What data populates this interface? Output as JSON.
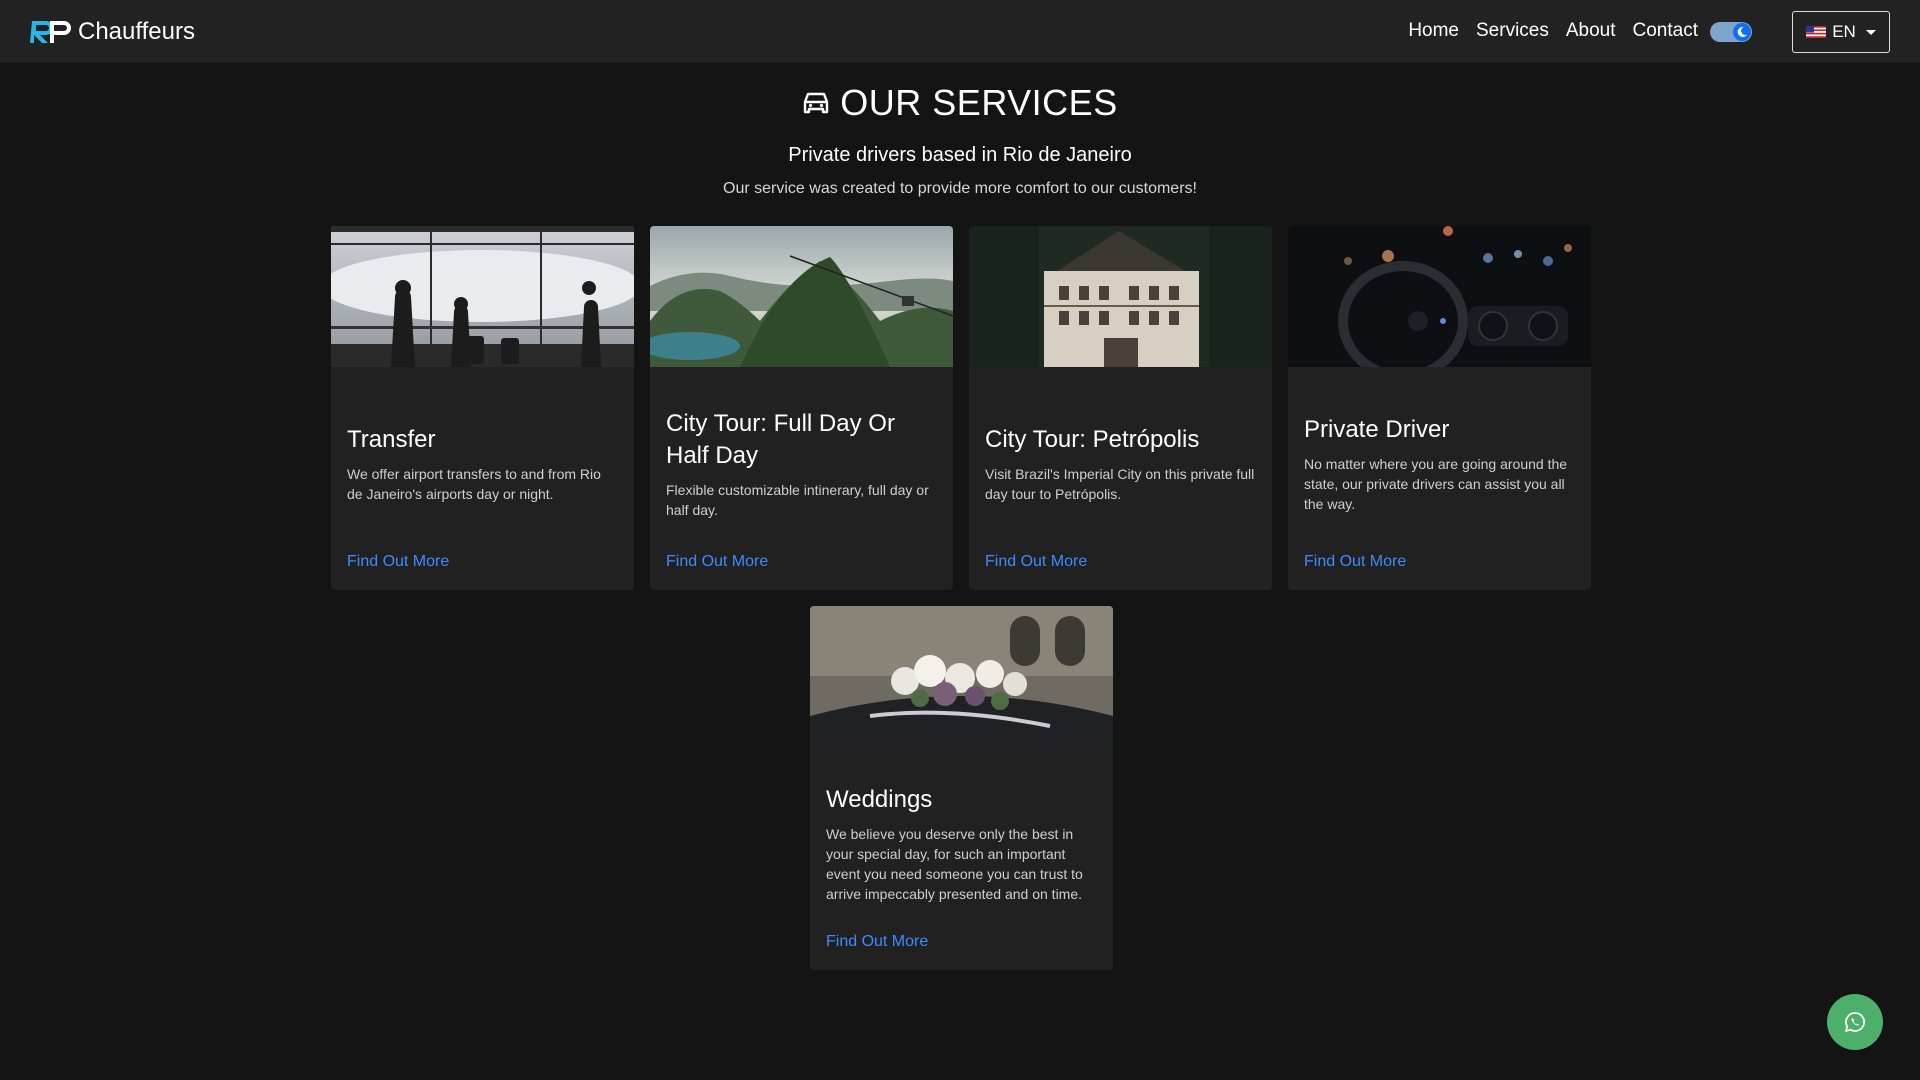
{
  "brand": {
    "text": "Chauffeurs"
  },
  "nav": {
    "items": [
      {
        "label": "Home"
      },
      {
        "label": "Services"
      },
      {
        "label": "About"
      },
      {
        "label": "Contact"
      }
    ],
    "language": "EN"
  },
  "header": {
    "title": "OUR SERVICES",
    "subtitle": "Private drivers based in Rio de Janeiro",
    "lead": "Our service was created to provide more comfort to our customers!"
  },
  "cards": [
    {
      "title": "Transfer",
      "text": "We offer airport transfers to and from Rio de Janeiro's airports day or night.",
      "link": "Find Out More"
    },
    {
      "title": "City Tour: Full Day Or Half Day",
      "text": "Flexible customizable intinerary, full day or half day.",
      "link": "Find Out More"
    },
    {
      "title": "City Tour: Petrópolis",
      "text": "Visit Brazil's Imperial City on this private full day tour to Petrópolis.",
      "link": "Find Out More"
    },
    {
      "title": "Private Driver",
      "text": "No matter where you are going around the state, our private drivers can assist you all the way.",
      "link": "Find Out More"
    },
    {
      "title": "Weddings",
      "text": "We believe you deserve only the best in your special day, for such an important event you need someone you can trust to arrive impeccably presented and on time.",
      "link": "Find Out More"
    }
  ],
  "icons": {
    "logo": "rp-logo-icon",
    "theme": "moon-icon",
    "flag": "us-flag-icon",
    "section": "car-icon",
    "chat": "whatsapp-icon"
  },
  "colors": {
    "background": "#141414",
    "navbar": "#222222",
    "card": "#212121",
    "link": "#3d8bfd",
    "whatsapp": "#4caf6a",
    "logo_accent": "#29b6e6"
  }
}
